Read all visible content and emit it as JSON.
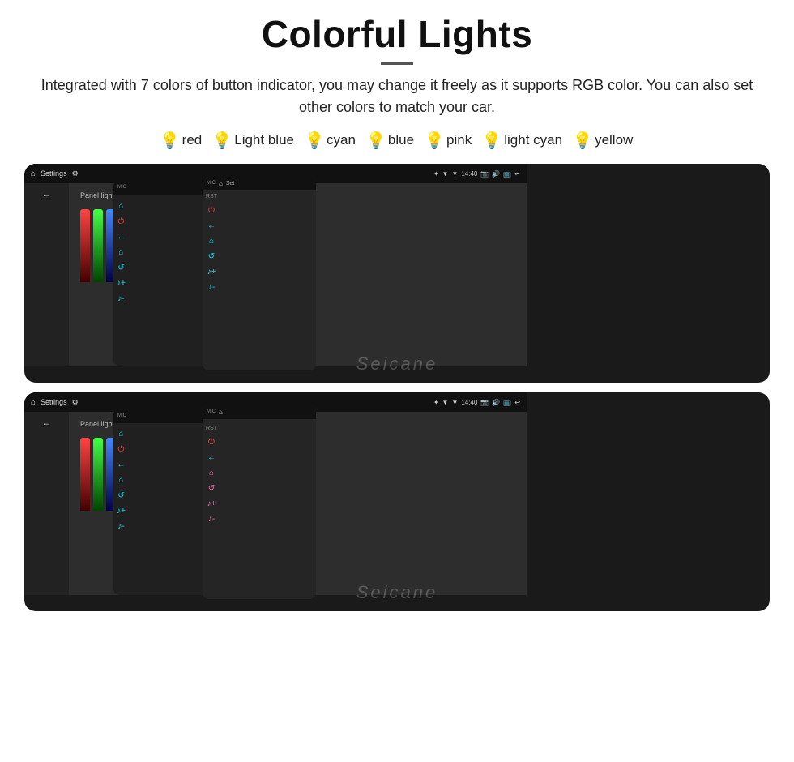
{
  "header": {
    "title": "Colorful Lights",
    "divider": true,
    "description": "Integrated with 7 colors of button indicator, you may change it freely as it supports RGB color. You can also set other colors to match your car."
  },
  "colors": [
    {
      "name": "red",
      "color": "#ff2222",
      "bulb": "🔴"
    },
    {
      "name": "Light blue",
      "color": "#88ccff",
      "bulb": "🔵"
    },
    {
      "name": "cyan",
      "color": "#00e5ff",
      "bulb": "🔵"
    },
    {
      "name": "blue",
      "color": "#2244ff",
      "bulb": "🔵"
    },
    {
      "name": "pink",
      "color": "#ff69b4",
      "bulb": "🔴"
    },
    {
      "name": "light cyan",
      "color": "#aaeeff",
      "bulb": "🔵"
    },
    {
      "name": "yellow",
      "color": "#ffee00",
      "bulb": "🟡"
    }
  ],
  "screens": [
    {
      "id": "top-group",
      "watermark": "Seicane"
    },
    {
      "id": "bottom-group",
      "watermark": "Seicane"
    }
  ],
  "settings_screen": {
    "title": "Settings",
    "time": "14:40",
    "panel_light_label": "Panel light color"
  }
}
